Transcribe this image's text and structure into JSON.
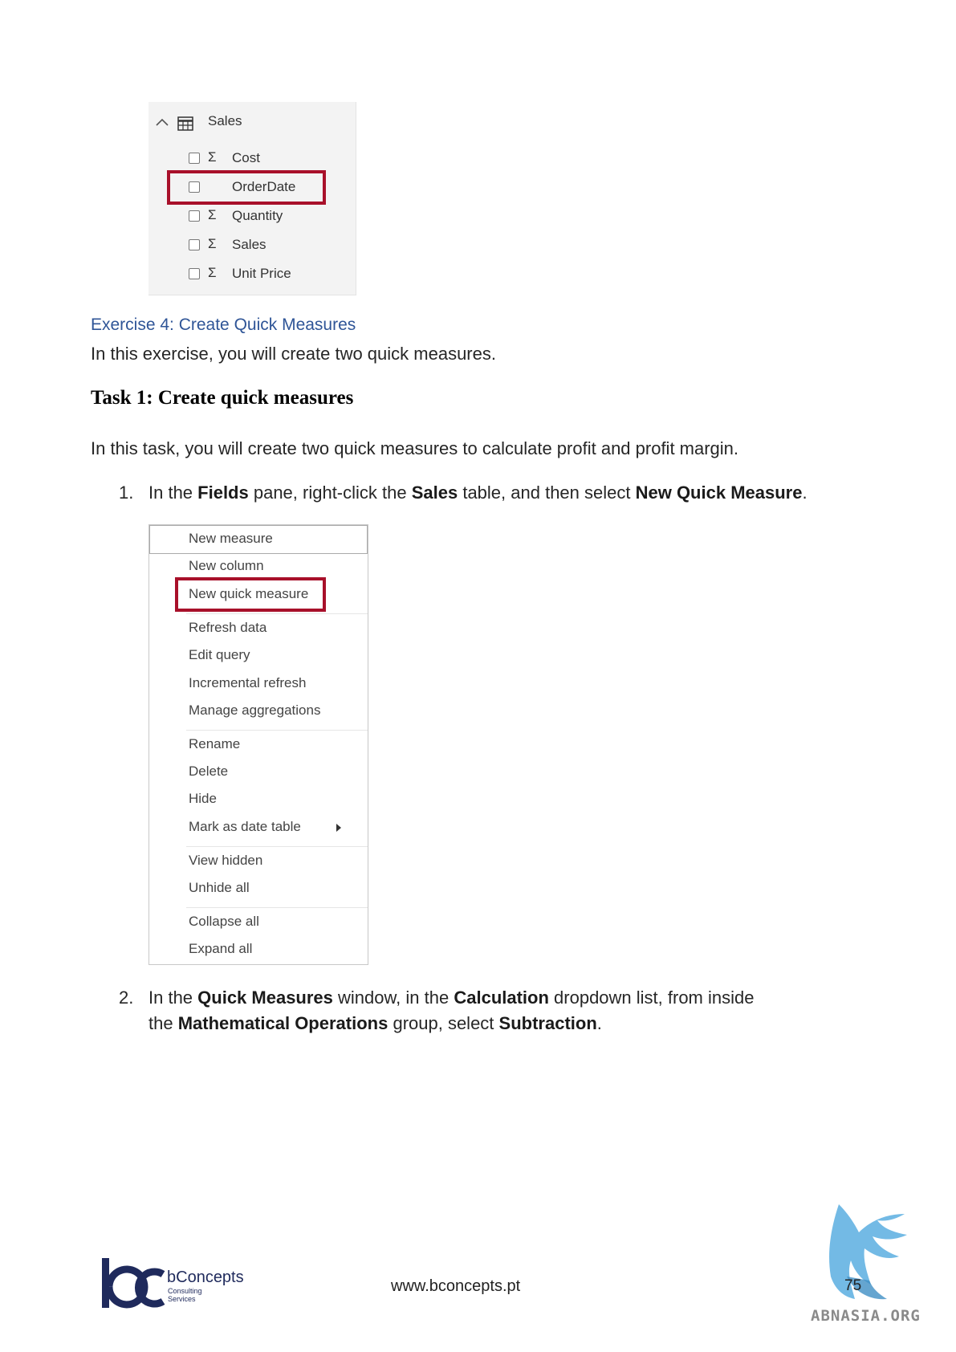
{
  "fields_pane": {
    "table_name": "Sales",
    "fields": [
      {
        "label": "Cost",
        "sigma": true,
        "highlighted": false
      },
      {
        "label": "OrderDate",
        "sigma": false,
        "highlighted": true
      },
      {
        "label": "Quantity",
        "sigma": true,
        "highlighted": false
      },
      {
        "label": "Sales",
        "sigma": true,
        "highlighted": false
      },
      {
        "label": "Unit Price",
        "sigma": true,
        "highlighted": false
      }
    ],
    "sigma_glyph": "Σ",
    "highlight_color": "#a8102a"
  },
  "exercise": {
    "title": "Exercise 4: Create Quick Measures",
    "intro": "In this exercise, you will create two quick measures."
  },
  "task": {
    "heading": "Task 1: Create quick measures",
    "intro": "In this task, you will create two quick measures to calculate profit and profit margin."
  },
  "steps": [
    {
      "number": "1.",
      "parts": [
        {
          "t": "In the ",
          "b": false
        },
        {
          "t": "Fields",
          "b": true
        },
        {
          "t": " pane, right-click the ",
          "b": false
        },
        {
          "t": "Sales",
          "b": true
        },
        {
          "t": " table, and then select ",
          "b": false
        },
        {
          "t": "New Quick Measure",
          "b": true
        },
        {
          "t": ".",
          "b": false
        }
      ]
    },
    {
      "number": "2.",
      "line1": [
        {
          "t": "In the ",
          "b": false
        },
        {
          "t": "Quick Measures",
          "b": true
        },
        {
          "t": " window, in the ",
          "b": false
        },
        {
          "t": "Calculation",
          "b": true
        },
        {
          "t": " dropdown list, from inside",
          "b": false
        }
      ],
      "line2": [
        {
          "t": "the ",
          "b": false
        },
        {
          "t": "Mathematical Operations",
          "b": true
        },
        {
          "t": " group, select ",
          "b": false
        },
        {
          "t": "Subtraction",
          "b": true
        },
        {
          "t": ".",
          "b": false
        }
      ]
    }
  ],
  "context_menu": {
    "items": [
      "New measure",
      "New column",
      "New quick measure",
      "Refresh data",
      "Edit query",
      "Incremental refresh",
      "Manage aggregations",
      "Rename",
      "Delete",
      "Hide",
      "Mark as date table",
      "View hidden",
      "Unhide all",
      "Collapse all",
      "Expand all"
    ],
    "highlighted_item": "New quick measure"
  },
  "footer": {
    "brand_name": "bConcepts",
    "brand_sub1": "Consulting",
    "brand_sub2": "Services",
    "url": "www.bconcepts.pt",
    "page_number": "75",
    "watermark": "ABNASIA.ORG",
    "brand_color": "#1f2a5c",
    "watermark_color": "#5aaee0"
  }
}
